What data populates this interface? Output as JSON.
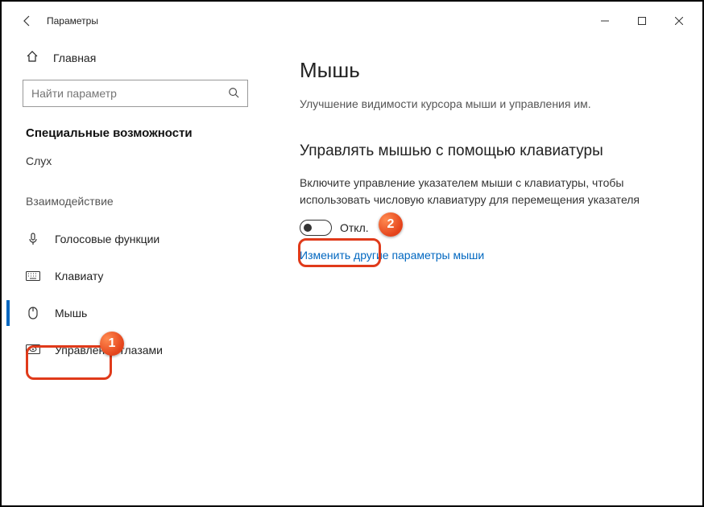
{
  "window": {
    "title": "Параметры"
  },
  "sidebar": {
    "home": "Главная",
    "search_placeholder": "Найти параметр",
    "group_title": "Специальные возможности",
    "hearing_label": "Слух",
    "interaction_label": "Взаимодействие",
    "items": {
      "speech": "Голосовые функции",
      "keyboard": "Клавиату",
      "mouse": "Мышь",
      "eye": "Управление глазами"
    }
  },
  "main": {
    "title": "Мышь",
    "subtitle": "Улучшение видимости курсора мыши и управления им.",
    "section_heading": "Управлять мышью с помощью клавиатуры",
    "section_desc": "Включите управление указателем мыши с клавиатуры, чтобы использовать числовую клавиатуру для перемещения указателя",
    "toggle_label": "Откл.",
    "link": "Изменить другие параметры мыши"
  },
  "badges": {
    "one": "1",
    "two": "2"
  }
}
